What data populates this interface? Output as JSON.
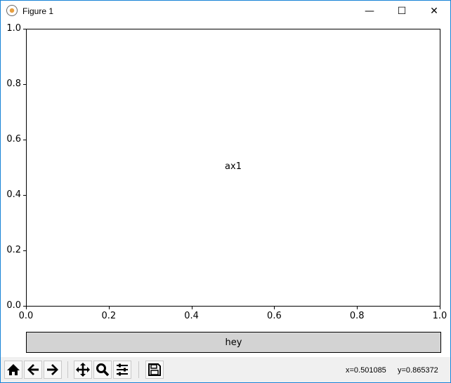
{
  "window": {
    "title": "Figure 1",
    "minimize": "—",
    "maximize": "☐",
    "close": "✕"
  },
  "axes": {
    "label": "ax1",
    "xticks": [
      "0.0",
      "0.2",
      "0.4",
      "0.6",
      "0.8",
      "1.0"
    ],
    "yticks": [
      "0.0",
      "0.2",
      "0.4",
      "0.6",
      "0.8",
      "1.0"
    ],
    "xlim": [
      0,
      1
    ],
    "ylim": [
      0,
      1
    ]
  },
  "button": {
    "label": "hey",
    "color": "#d3d3d3"
  },
  "toolbar": {
    "buttons": [
      "home-icon",
      "back-icon",
      "forward-icon",
      "pan-icon",
      "zoom-icon",
      "configure-subplots-icon",
      "save-icon"
    ],
    "x_readout": "x=0.501085",
    "y_readout": "y=0.865372"
  }
}
